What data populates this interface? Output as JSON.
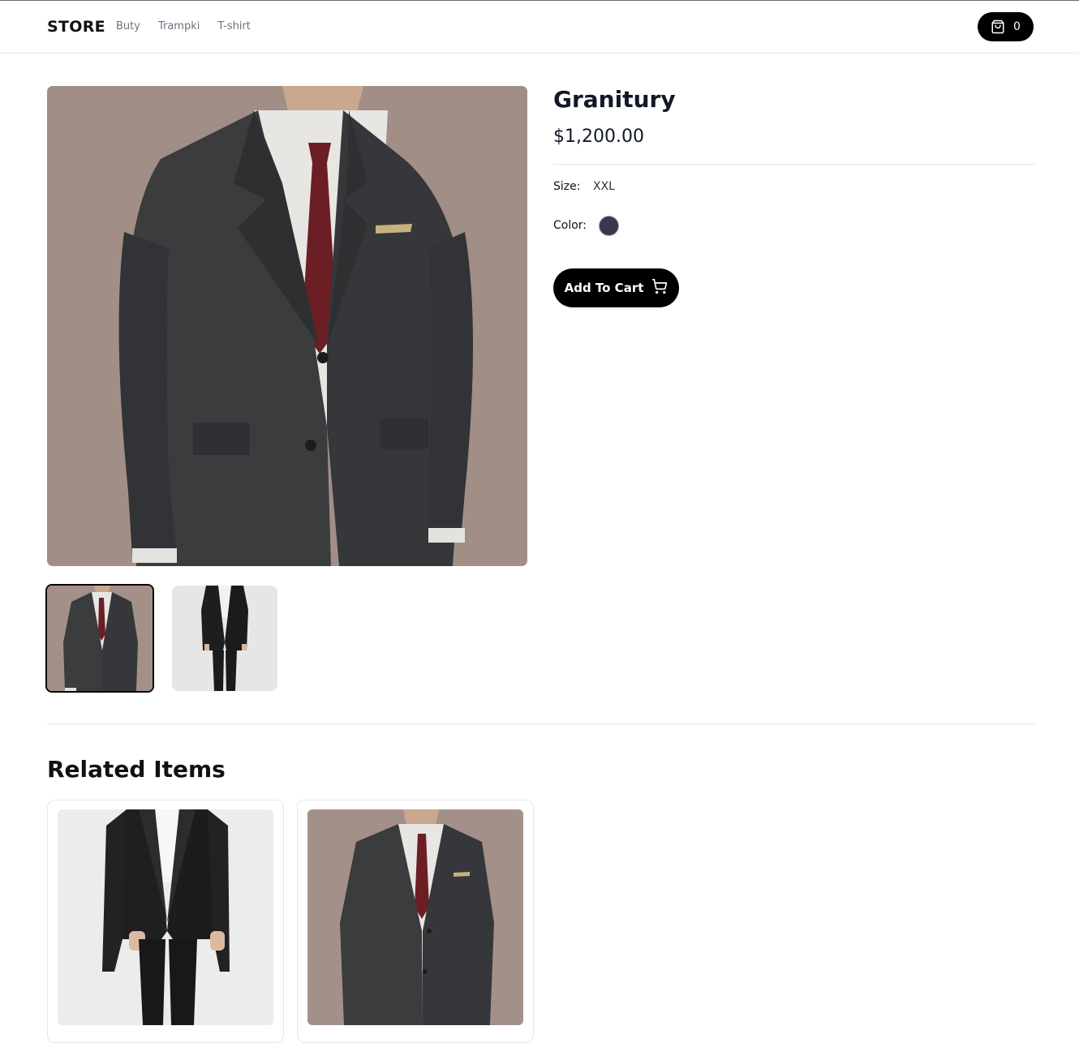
{
  "header": {
    "brand": "STORE",
    "nav": [
      "Buty",
      "Trampki",
      "T-shirt"
    ],
    "cart_count": "0"
  },
  "product": {
    "title": "Granitury",
    "price": "$1,200.00",
    "size_label": "Size:",
    "size_value": "XXL",
    "color_label": "Color:",
    "color_hex": "#3f3450",
    "add_to_cart": "Add To Cart"
  },
  "related": {
    "title": "Related Items"
  },
  "icons": {
    "cart": "shopping-bag-icon",
    "add": "shopping-cart-icon"
  }
}
